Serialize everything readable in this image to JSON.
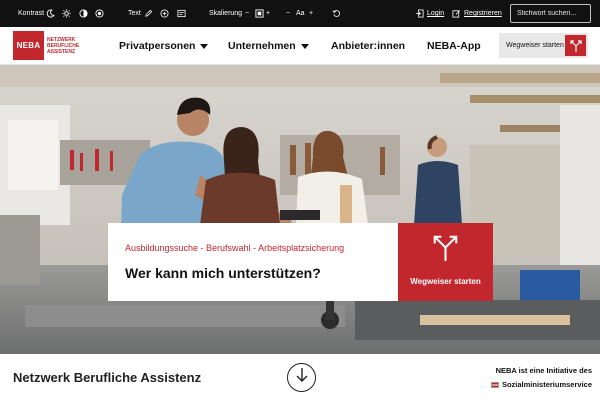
{
  "topbar": {
    "contrast_label": "Kontrast",
    "text_label": "Text",
    "scale_label": "Skalierung",
    "font_size_label": "Aa",
    "login_label": "Login",
    "register_label": "Registrieren",
    "search_placeholder": "Stichwort suchen..."
  },
  "nav": {
    "logo": "NEBA",
    "logo_sub": [
      "NETZWERK",
      "BERUFLICHE",
      "ASSISTENZ"
    ],
    "items": [
      {
        "label": "Privatpersonen",
        "has_dropdown": true
      },
      {
        "label": "Unternehmen",
        "has_dropdown": true
      },
      {
        "label": "Anbieter:innen",
        "has_dropdown": false
      },
      {
        "label": "NEBA-App",
        "has_dropdown": false
      }
    ],
    "cta_label": "Wegweiser starten",
    "cta_icon": "signpost-arrows-icon"
  },
  "hero": {
    "kicker": "Ausbildungssuche - Berufswahl - Arbeitsplatzsicherung",
    "headline": "Wer kann mich unterstützen?",
    "button_label": "Wegweiser starten",
    "button_icon": "signpost-arrows-icon"
  },
  "footer": {
    "site_title": "Netzwerk Berufliche Assistenz",
    "initiative_line1": "NEBA ist eine Initiative des",
    "initiative_line2": "Sozialministeriumservice",
    "scroll_icon": "arrow-down-icon"
  },
  "colors": {
    "brand_red": "#c1272d",
    "topbar_bg": "#111111",
    "cta_bg": "#e8e8e8"
  }
}
